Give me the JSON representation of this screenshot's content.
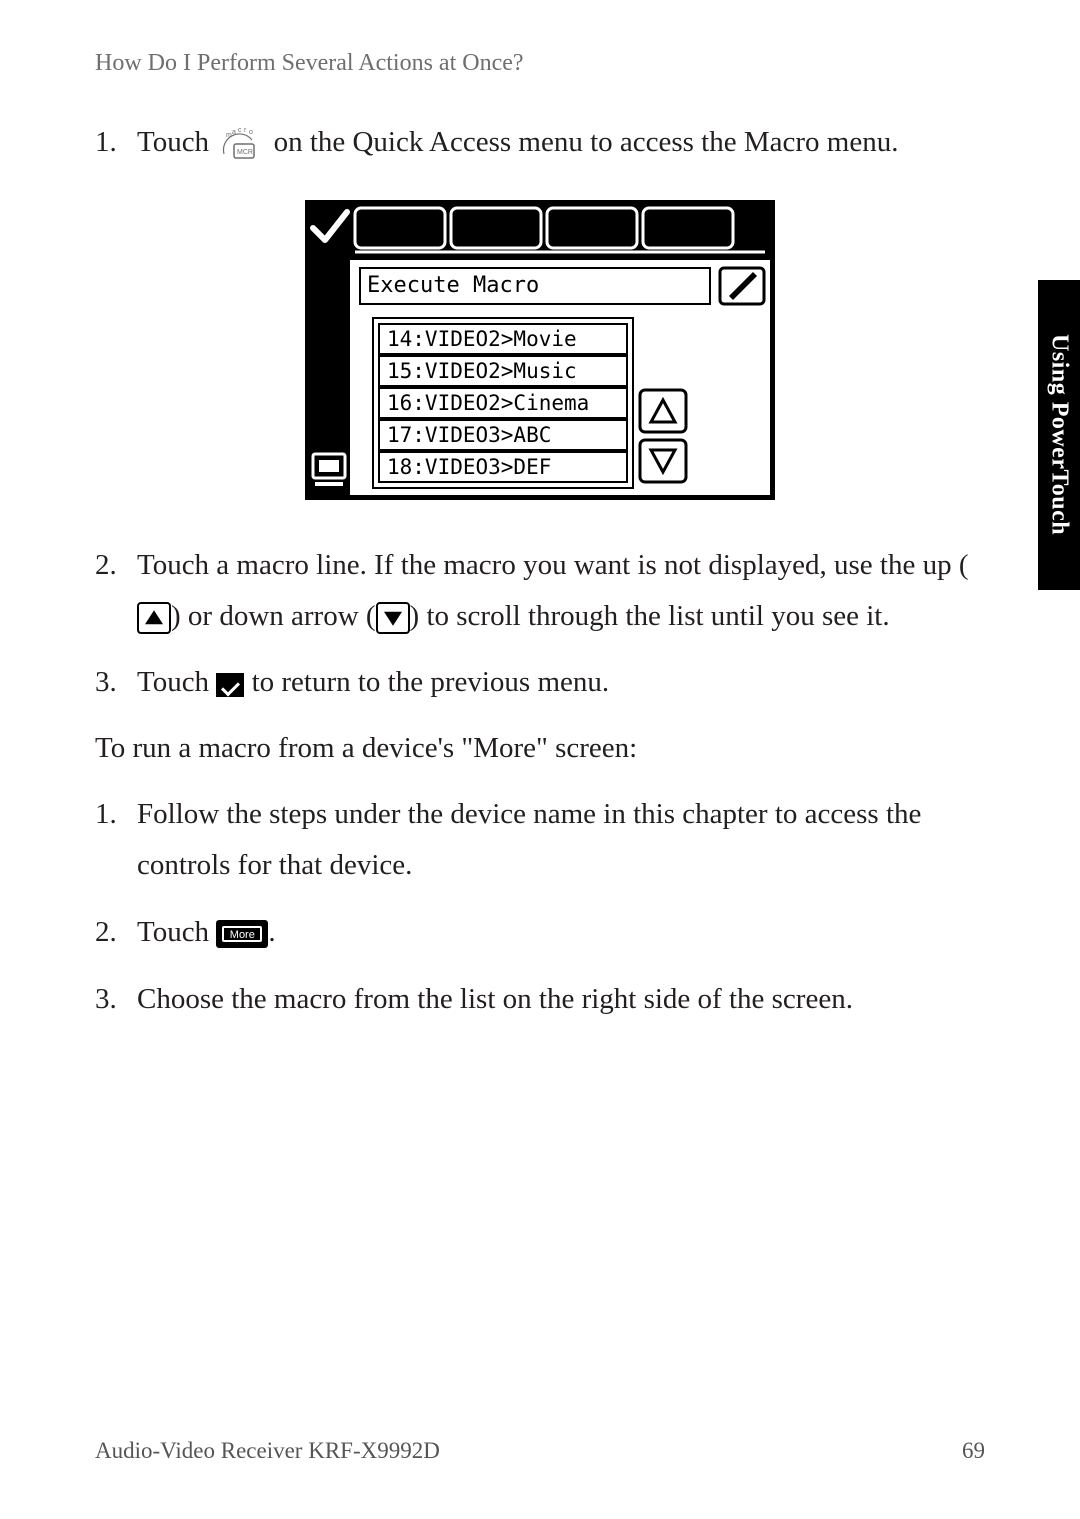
{
  "header": "How Do I Perform Several Actions at Once?",
  "step1a": "Touch ",
  "step1b": " on the Quick Access menu to access the Macro menu.",
  "screenshot": {
    "title": "Execute Macro",
    "rows": [
      "14:VIDEO2>Movie",
      "15:VIDEO2>Music",
      "16:VIDEO2>Cinema",
      "17:VIDEO3>ABC",
      "18:VIDEO3>DEF"
    ]
  },
  "step2a": "Touch a macro line. If the macro you want is not displayed, use the up (",
  "step2b": ") or down arrow (",
  "step2c": ") to scroll through the list until you see it.",
  "step3a": "Touch ",
  "step3b": " to return to the previous menu.",
  "subhead": "To run a macro from a device's \"More\" screen:",
  "bstep1": "Follow the steps under the device name in this chapter to access the controls for that device.",
  "bstep2a": "Touch ",
  "bstep2b": ".",
  "more_label": "More",
  "bstep3": "Choose the macro from the list on the right side of the screen.",
  "side_tab": "Using PowerTouch",
  "footer_left": "Audio-Video Receiver KRF-X9992D",
  "footer_right": "69",
  "nums": {
    "n1": "1.",
    "n2": "2.",
    "n3": "3."
  }
}
